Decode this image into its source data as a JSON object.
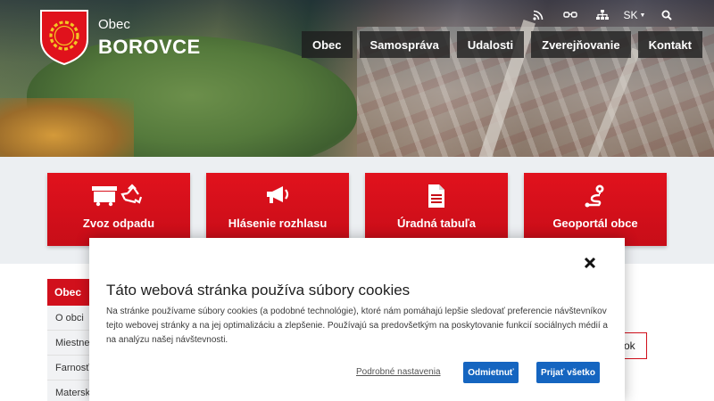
{
  "header": {
    "brand_small": "Obec",
    "brand_big": "BOROVCE",
    "top_icons": [
      "rss-icon",
      "accessibility-glasses-icon",
      "sitemap-icon"
    ],
    "language": "SK",
    "nav": [
      "Obec",
      "Samospráva",
      "Udalosti",
      "Zverejňovanie",
      "Kontakt"
    ]
  },
  "tiles": [
    {
      "label": "Zvoz odpadu",
      "icon": "waste-recycle-icon"
    },
    {
      "label": "Hlásenie rozhlasu",
      "icon": "megaphone-icon"
    },
    {
      "label": "Úradná tabuľa",
      "icon": "document-icon"
    },
    {
      "label": "Geoportál obce",
      "icon": "map-route-icon"
    }
  ],
  "side_menu": {
    "head": "Obec",
    "items": [
      "O obci",
      "Miestne",
      "Farnosť",
      "Materská"
    ]
  },
  "ok_button": "ok",
  "cookie": {
    "title": "Táto webová stránka používa súbory cookies",
    "text": "Na stránke používame súbory cookies (a podobné technológie), ktoré nám pomáhajú lepšie sledovať preferencie návštevníkov tejto webovej stránky a na jej optimalizáciu a zlepšenie. Používajú sa predovšetkým na poskytovanie funkcií sociálnych médií a na analýzu našej návštevnosti.",
    "settings_link": "Podrobné nastavenia",
    "reject": "Odmietnuť",
    "accept_all": "Prijať všetko"
  },
  "colors": {
    "brand_red": "#d1101c",
    "button_blue": "#1565c0"
  }
}
